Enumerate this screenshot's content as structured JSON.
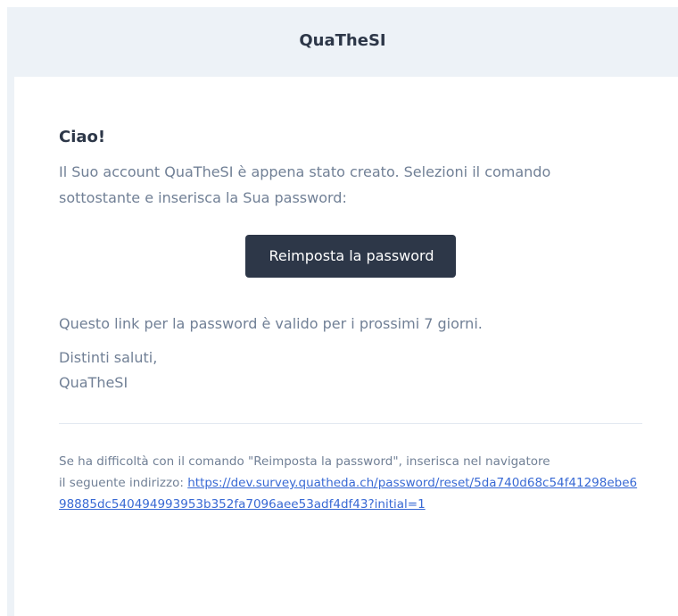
{
  "header": {
    "brand": "QuaTheSI"
  },
  "email": {
    "greeting": "Ciao!",
    "intro_line1": "Il Suo account QuaTheSI è appena stato creato. Selezioni il comando",
    "intro_line2": "sottostante e inserisca la Sua password:",
    "action_label": "Reimposta la password",
    "validity": "Questo link per la password è valido per i prossimi 7 giorni.",
    "salutation": "Distinti saluti,",
    "signature": "QuaTheSI",
    "subcopy_line1": "Se ha difficoltà con il comando \"Reimposta la password\", inserisca nel navigatore",
    "subcopy_prefix": "il seguente indirizzo:",
    "reset_url": "https://dev.survey.quatheda.ch/password/reset/5da740d68c54f41298ebe698885dc540494993953b352fa7096aee53adf4df43?initial=1"
  },
  "colors": {
    "frame_bg": "#edf2f7",
    "card_bg": "#ffffff",
    "heading": "#2d3748",
    "body_text": "#718096",
    "button_bg": "#2d3748",
    "button_text": "#ffffff",
    "link": "#3869d4",
    "divider": "#e2e8f0"
  }
}
